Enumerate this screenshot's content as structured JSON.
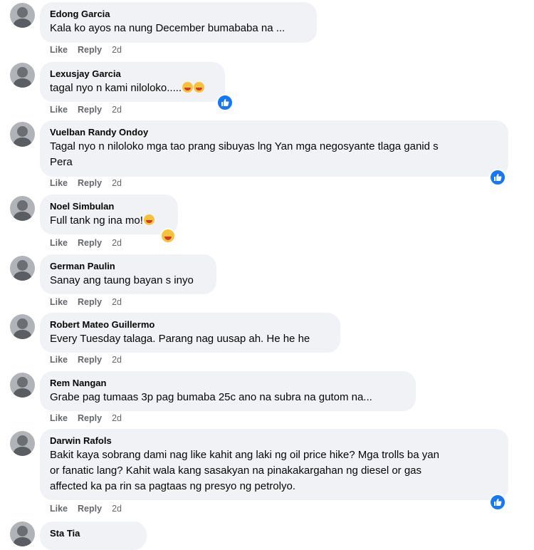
{
  "comments": [
    {
      "name": "Edong Garcia",
      "text": "Kala ko ayos na nung December bumababa na ...",
      "like": "Like",
      "reply": "Reply",
      "time": "2d"
    },
    {
      "name": "Lexusjay Garcia",
      "text": "tagal nyo n kami niloloko.....",
      "like": "Like",
      "reply": "Reply",
      "time": "2d",
      "reaction": "like-icon"
    },
    {
      "name": "Vuelban Randy Ondoy",
      "text_line1": "Tagal nyo n niloloko mga tao prang sibuyas lng Yan mga negosyante tlaga ganid s",
      "text_line2": "Pera",
      "like": "Like",
      "reply": "Reply",
      "time": "2d",
      "reaction": "like-icon"
    },
    {
      "name": "Noel Simbulan",
      "text": "Full tank ng ina mo!",
      "like": "Like",
      "reply": "Reply",
      "time": "2d",
      "reaction": "laugh-icon"
    },
    {
      "name": "German Paulin",
      "text": "Sanay ang taung bayan s inyo",
      "like": "Like",
      "reply": "Reply",
      "time": "2d"
    },
    {
      "name": "Robert Mateo Guillermo",
      "text": "Every Tuesday talaga. Parang nag uusap ah. He he he",
      "like": "Like",
      "reply": "Reply",
      "time": "2d"
    },
    {
      "name": "Rem Nangan",
      "text": "Grabe pag tumaas 3p pag bumaba 25c ano na subra na gutom na...",
      "like": "Like",
      "reply": "Reply",
      "time": "2d"
    },
    {
      "name": "Darwin Rafols",
      "text_line1": "Bakit kaya sobrang dami nag like kahit ang laki ng oil price hike? Mga trolls ba yan",
      "text_line2": "or fanatic lang? Kahit wala kang sasakyan na pinakakargahan ng diesel or gas",
      "text_line3": "affected ka pa rin sa pagtaas ng presyo ng petrolyo.",
      "like": "Like",
      "reply": "Reply",
      "time": "2d",
      "reaction": "like-icon"
    },
    {
      "name": "Sta Tia"
    }
  ],
  "colors": {
    "bubble": "#f0f2f5",
    "like_blue": "#1877f2",
    "meta": "#65676b"
  }
}
